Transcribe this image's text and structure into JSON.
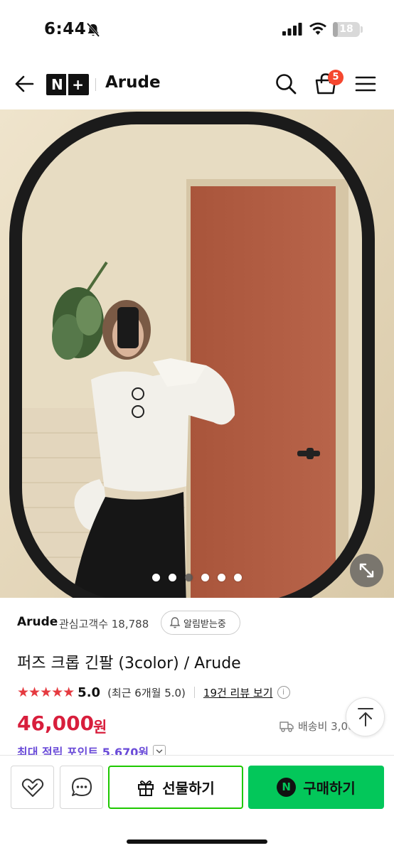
{
  "status_bar": {
    "time": "6:44",
    "battery": "18",
    "battery_level": 0.18
  },
  "header": {
    "logo_text_left": "N",
    "logo_text_right": "+",
    "store_name": "Arude",
    "cart_count": "5"
  },
  "gallery": {
    "image_count": 6,
    "active_index": 2
  },
  "product": {
    "brand": "Arude",
    "interest_label": "관심고객수 18,788",
    "notify_label": "알림받는중",
    "title": "퍼즈 크롭 긴팔 (3color) / Arude",
    "stars": "★★★★★",
    "rating": "5.0",
    "rating_recent": "(최근 6개월 5.0)",
    "review_link": "19건 리뷰 보기",
    "info_glyph": "i",
    "price": "46,000",
    "price_unit": "원",
    "shipping": "배송비 3,000원",
    "points": "최대 적립 포인트 5,670원"
  },
  "bottom_bar": {
    "gift_label": "선물하기",
    "buy_label": "구매하기",
    "npay_glyph": "N"
  },
  "colors": {
    "accent_red": "#d81e3c",
    "naver_green": "#03c75a",
    "points_purple": "#6a4bd8",
    "badge_red": "#f5472f"
  }
}
